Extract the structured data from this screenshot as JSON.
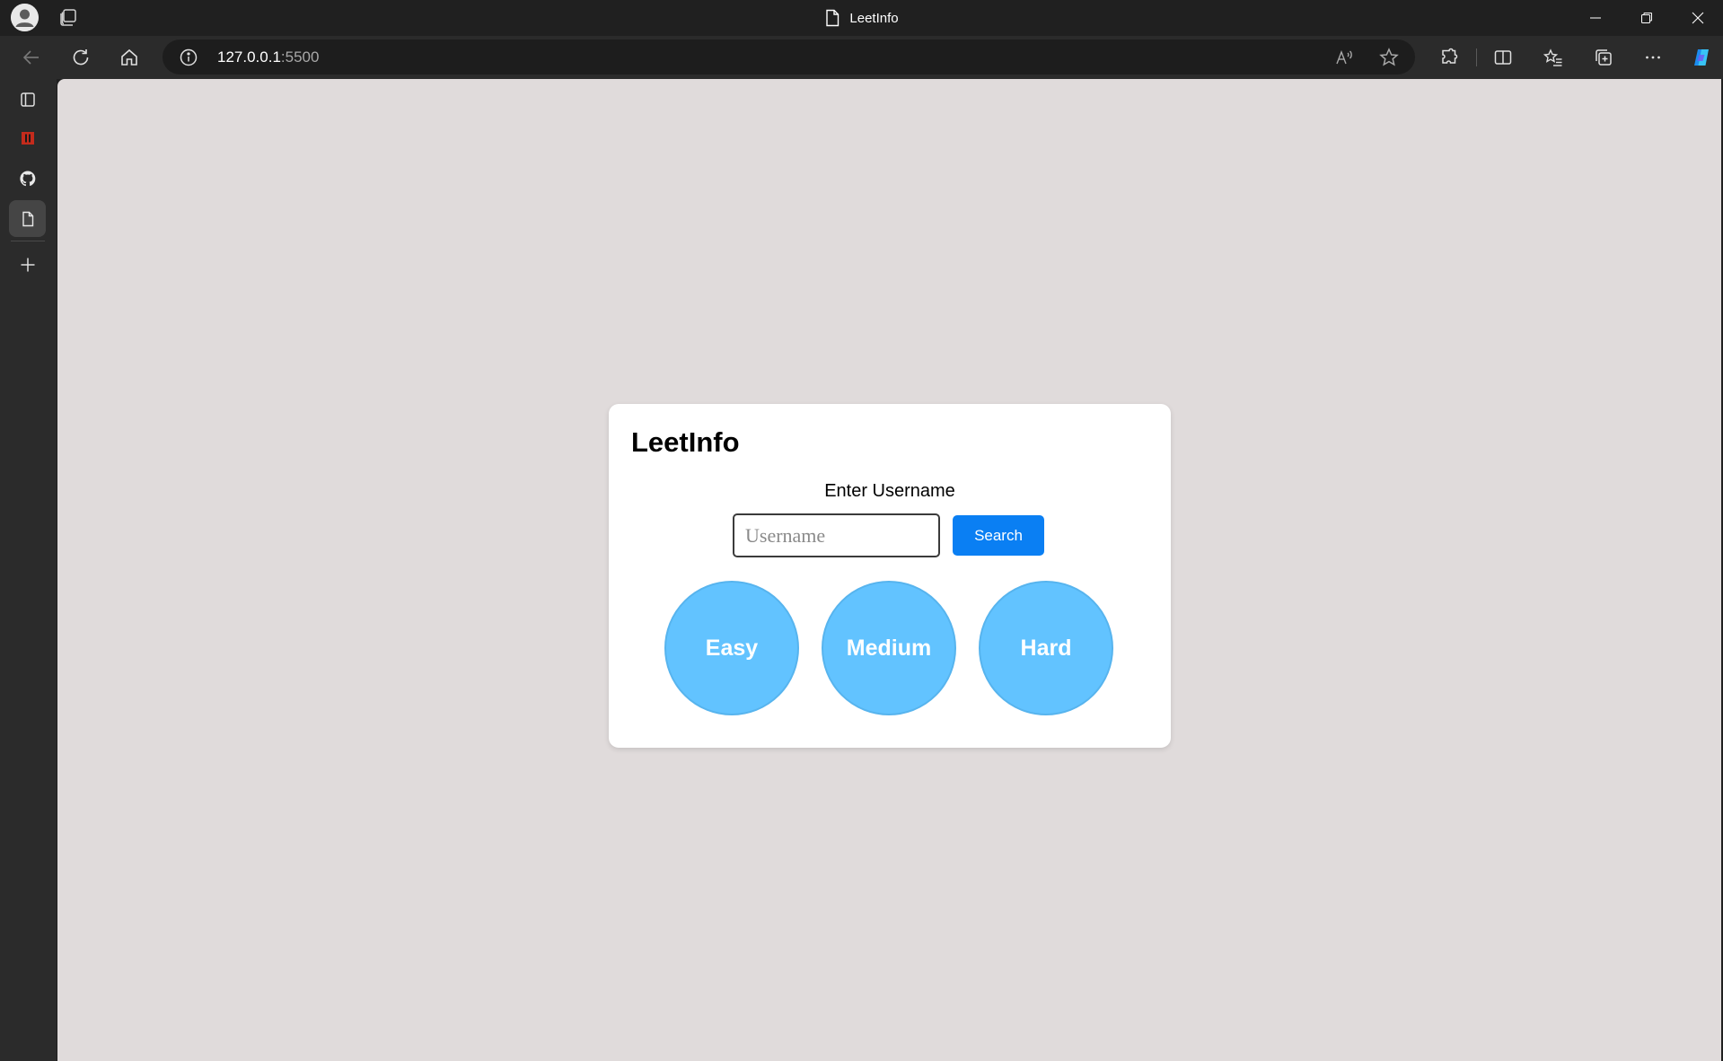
{
  "browser": {
    "tab_title": "LeetInfo",
    "url_host": "127.0.0.1",
    "url_port": ":5500"
  },
  "colors": {
    "page_background": "#e0dbdb",
    "card_background": "#ffffff",
    "search_button": "#0a7ff3",
    "difficulty_circle": "#62c3ff",
    "browser_chrome": "#202020"
  },
  "icons": {
    "titlebar": [
      "profile-icon",
      "tab-actions-icon",
      "document-icon",
      "minimize-icon",
      "restore-icon",
      "close-icon"
    ],
    "toolbar": [
      "back-icon",
      "refresh-icon",
      "home-icon",
      "info-icon",
      "read-aloud-icon",
      "favorite-star-icon",
      "extensions-icon",
      "split-screen-icon",
      "favorites-icon",
      "collections-icon",
      "more-icon",
      "copilot-icon"
    ],
    "sidebar": [
      "sidebar-panel-icon",
      "red-app-icon",
      "github-icon",
      "document-icon",
      "add-icon"
    ]
  },
  "app": {
    "title": "LeetInfo",
    "prompt_label": "Enter Username",
    "username_placeholder": "Username",
    "username_value": "",
    "search_label": "Search",
    "difficulties": [
      "Easy",
      "Medium",
      "Hard"
    ]
  }
}
